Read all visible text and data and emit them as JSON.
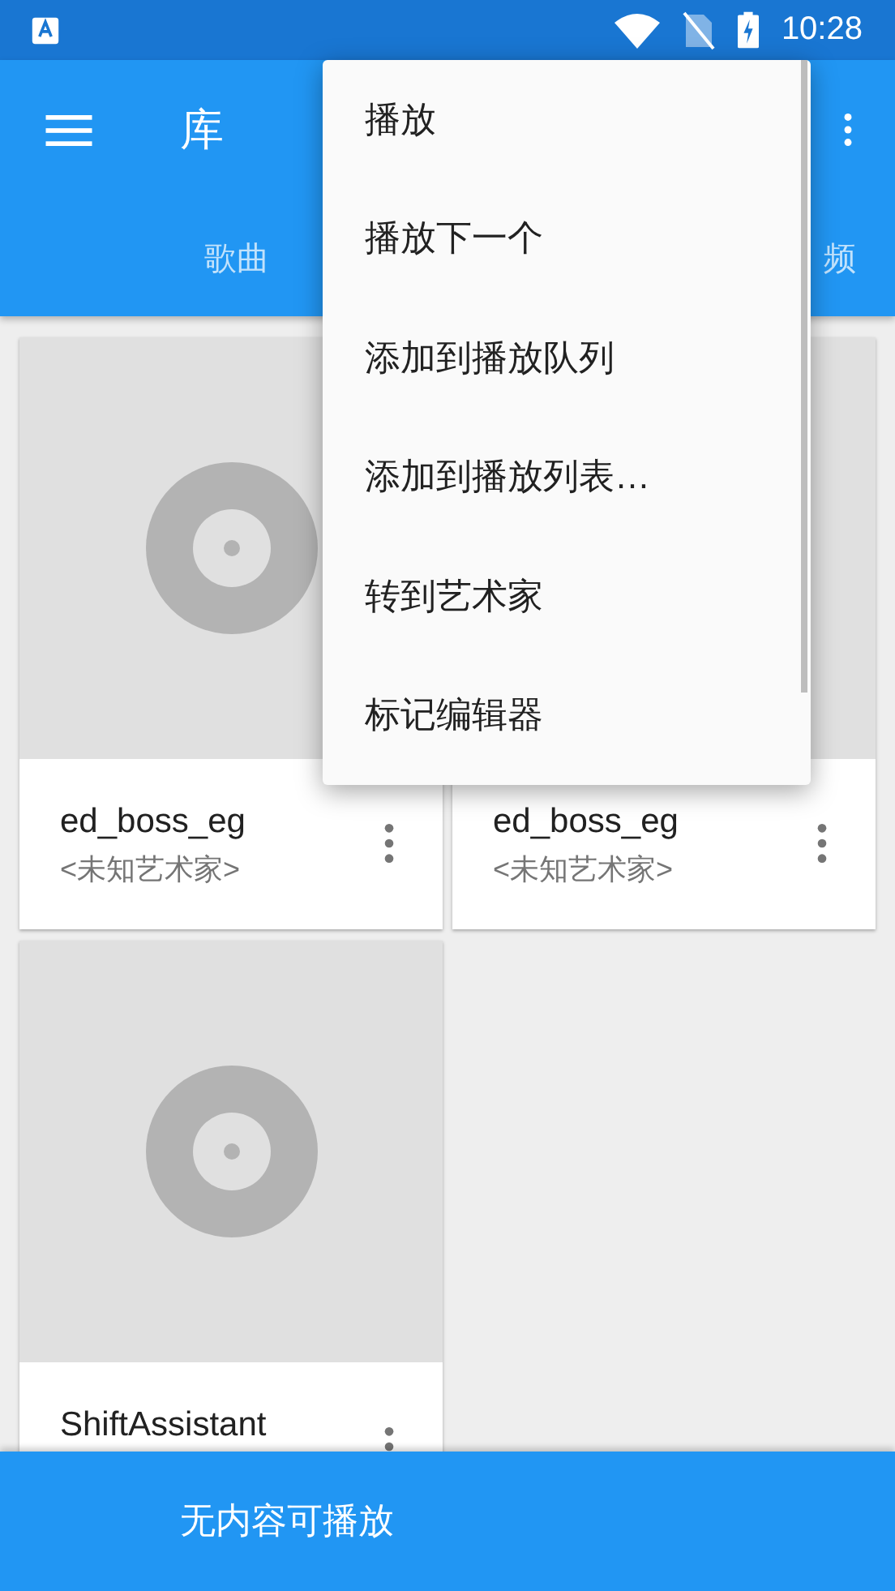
{
  "status_bar": {
    "time": "10:28"
  },
  "app_bar": {
    "title": "库"
  },
  "tabs": [
    {
      "label": "歌曲",
      "selected": false
    },
    {
      "label": "频",
      "selected": false
    }
  ],
  "cards": [
    {
      "title": "ed_boss_eg",
      "subtitle": "<未知艺术家>",
      "kind": "disc"
    },
    {
      "title": "ed_boss_eg",
      "subtitle": "<未知艺术家>",
      "kind": "plain"
    },
    {
      "title": "ShiftAssistant",
      "kind": "disc"
    }
  ],
  "now_playing": {
    "text": "无内容可播放"
  },
  "menu": {
    "items": [
      "播放",
      "播放下一个",
      "添加到播放队列",
      "添加到播放列表…",
      "转到艺术家",
      "标记编辑器"
    ]
  }
}
